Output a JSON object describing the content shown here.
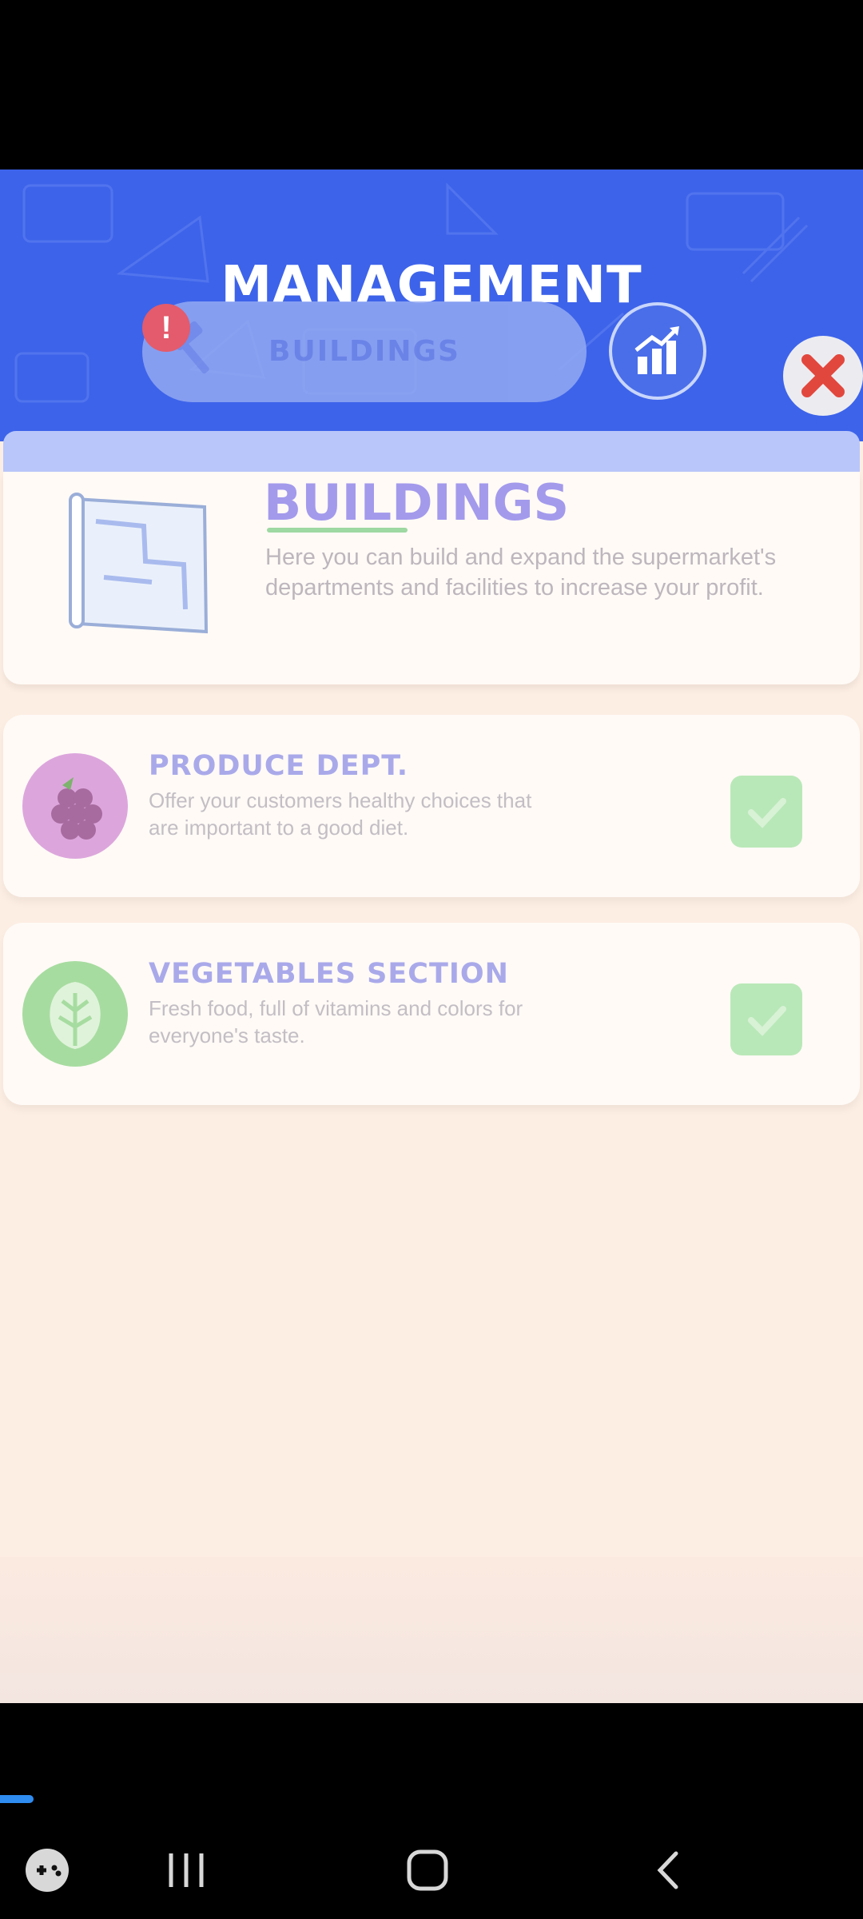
{
  "header": {
    "title": "MANAGEMENT",
    "active_tab_label": "BUILDINGS",
    "badge": "!"
  },
  "intro": {
    "title": "BUILDINGS",
    "description": "Here you can build and expand the supermarket's departments and facilities to increase your profit."
  },
  "items": [
    {
      "title": "PRODUCE DEPT.",
      "description": "Offer your customers healthy choices that are important to a good diet."
    },
    {
      "title": "VEGETABLES SECTION",
      "description": "Fresh food, full of vitamins and colors for everyone's taste."
    }
  ],
  "colors": {
    "header_blue": "#3d63ea",
    "title_purple": "#a39aec",
    "check_green": "#b9e8b8",
    "close_red": "#e2473d"
  },
  "icons": [
    "hammer-icon",
    "stats-chart-icon",
    "close-icon",
    "map-icon",
    "grapes-icon",
    "lettuce-icon",
    "checkmark-icon",
    "game-controller-icon",
    "recents-icon",
    "home-icon",
    "back-icon"
  ]
}
